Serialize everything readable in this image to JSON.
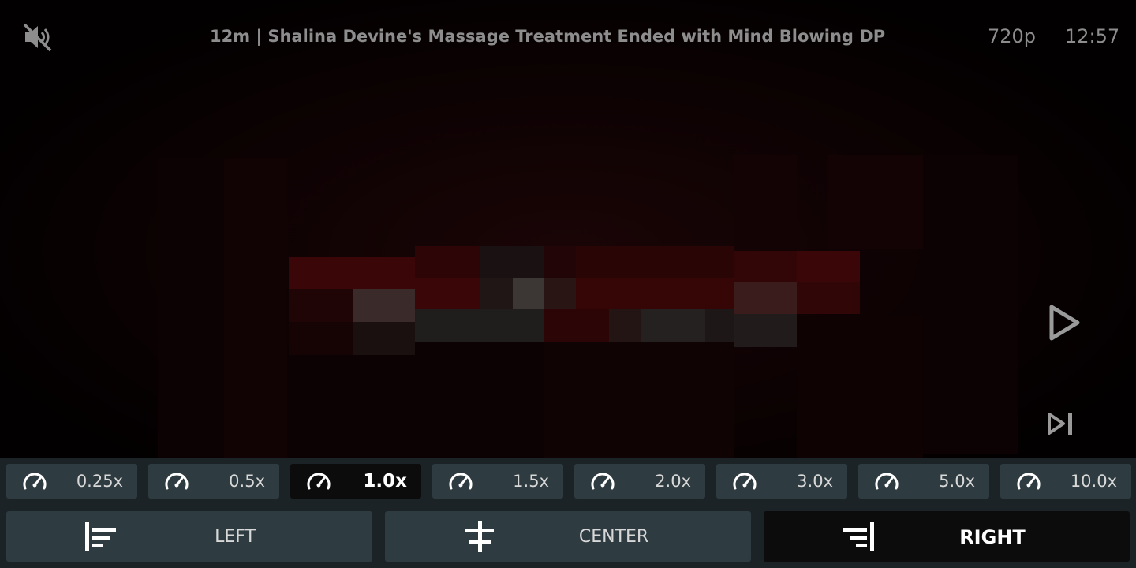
{
  "header": {
    "title": "12m | Shalina Devine's Massage Treatment Ended with Mind Blowing DP",
    "quality": "720p",
    "time": "12:57",
    "mute_icon": "muted-speaker-icon"
  },
  "player": {
    "play_icon": "play-icon",
    "next_icon": "skip-next-icon"
  },
  "speed_options": [
    {
      "label": "0.25x",
      "active": false
    },
    {
      "label": "0.5x",
      "active": false
    },
    {
      "label": "1.0x",
      "active": true
    },
    {
      "label": "1.5x",
      "active": false
    },
    {
      "label": "2.0x",
      "active": false
    },
    {
      "label": "3.0x",
      "active": false
    },
    {
      "label": "5.0x",
      "active": false
    },
    {
      "label": "10.0x",
      "active": false
    }
  ],
  "align_options": [
    {
      "label": "LEFT",
      "active": false,
      "icon": "align-left-icon"
    },
    {
      "label": "CENTER",
      "active": false,
      "icon": "align-center-icon"
    },
    {
      "label": "RIGHT",
      "active": true,
      "icon": "align-right-icon"
    }
  ],
  "colors": {
    "panel_bg": "#1b2327",
    "button_bg": "#2e3b41",
    "active_bg": "#0c0c0c",
    "header_text": "#8d8d8d"
  }
}
